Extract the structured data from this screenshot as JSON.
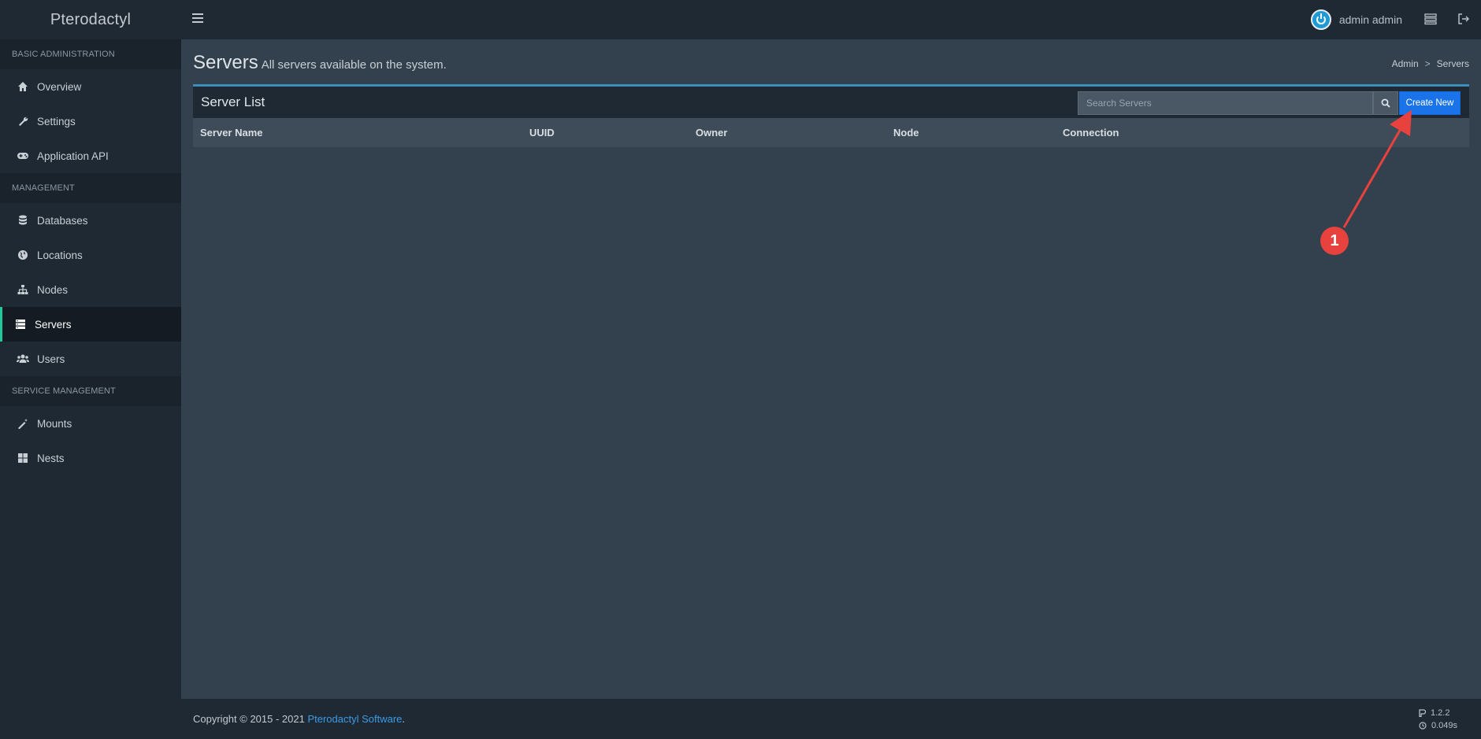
{
  "app": {
    "brand": "Pterodactyl"
  },
  "header": {
    "user_name": "admin admin",
    "icons": [
      "menu-icon",
      "server-icon",
      "logout-icon"
    ]
  },
  "sidebar": {
    "sections": [
      {
        "header": "BASIC ADMINISTRATION",
        "items": [
          {
            "label": "Overview",
            "icon": "home-icon"
          },
          {
            "label": "Settings",
            "icon": "wrench-icon"
          },
          {
            "label": "Application API",
            "icon": "gamepad-icon"
          }
        ]
      },
      {
        "header": "MANAGEMENT",
        "items": [
          {
            "label": "Databases",
            "icon": "database-icon"
          },
          {
            "label": "Locations",
            "icon": "globe-icon"
          },
          {
            "label": "Nodes",
            "icon": "sitemap-icon"
          },
          {
            "label": "Servers",
            "icon": "server-icon",
            "active": true
          },
          {
            "label": "Users",
            "icon": "users-icon"
          }
        ]
      },
      {
        "header": "SERVICE MANAGEMENT",
        "items": [
          {
            "label": "Mounts",
            "icon": "magic-icon"
          },
          {
            "label": "Nests",
            "icon": "th-large-icon"
          }
        ]
      }
    ]
  },
  "page": {
    "title": "Servers",
    "subtitle": "All servers available on the system.",
    "breadcrumb": [
      "Admin",
      "Servers"
    ]
  },
  "server_list": {
    "title": "Server List",
    "search_placeholder": "Search Servers",
    "create_label": "Create New",
    "columns": [
      "Server Name",
      "UUID",
      "Owner",
      "Node",
      "Connection"
    ],
    "rows": []
  },
  "footer": {
    "copyright": "Copyright © 2015 - 2021",
    "link_text": "Pterodactyl Software",
    "period": ".",
    "version": "1.2.2",
    "render_time": "0.049s"
  },
  "annotation": {
    "label": "1",
    "color": "#e8423f"
  },
  "colors": {
    "accent": "#1a73e8",
    "active_border": "#20c997",
    "box_top": "#3c8dbc"
  }
}
